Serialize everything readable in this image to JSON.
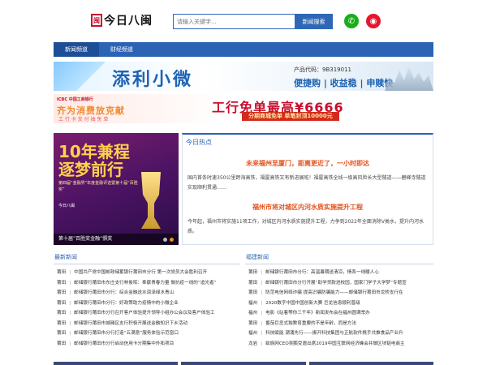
{
  "header": {
    "logo_seal": "闽",
    "logo_text": "今日八闽",
    "search_placeholder": "请输入关键字...",
    "search_button": "新闻搜索"
  },
  "nav": {
    "items": [
      {
        "label": "新闻频道"
      },
      {
        "label": "财经频道"
      }
    ]
  },
  "banner1": {
    "title": "添利小微",
    "product_code": "产品代码：9B319011",
    "slogan": "便捷购 | 收益稳 | 申赎快"
  },
  "banner2": {
    "bank_name": "ICBC 中国工商银行",
    "left_title": "齐为消费放克献",
    "left_sub": "工 行 卡 支 付 抽 免 单",
    "title": "工行免单最高¥6666",
    "subtitle": "分期商城免单 单笔封顶10000元"
  },
  "slider": {
    "big_text_1": "10年兼程",
    "big_text_2": "逐梦前行",
    "small_text": "第四届“金融界”年度金融评选暨第十届“百胜奖”",
    "logo_text": "今日八闽",
    "caption": "第十届”百胜奖金融”颁奖"
  },
  "hot": {
    "tag": "今日热点",
    "headline1": "未来福州至厦门，距离更近了，一小时即达",
    "para1": "国内首条时速350公里跨海高铁，福厦高铁又有新进展啦！福厦高铁全线一级高风险长大型隧道——碧峰寺隧道实现顺利贯通……",
    "headline2": "福州市将对城区内河水质实施提升工程",
    "para2": "今年起，福州市将实施11项工作，对城区内河水质实施提升工程，力争到2022年全面消除V类水，提升内河水质。"
  },
  "latest": {
    "title": "最新新闻",
    "items": [
      {
        "city": "莆田",
        "text": "中国共产党中国邮政储蓄银行莆田市分行 第一次党员大会胜利召开"
      },
      {
        "city": "莆田",
        "text": "邮储银行莆田市东庄支行林俊晖：奉献青春力量 做抗疫一线的“追光者”"
      },
      {
        "city": "莆田",
        "text": "邮储银行莆田市分行：综合金融送水润泽绿水青山"
      },
      {
        "city": "莆田",
        "text": "邮储银行莆田市分行：好政策助力疫情中的小微企业"
      },
      {
        "city": "莆田",
        "text": "邮储银行莆田市分行召开客户体验提升领导小组办公会议及客户体验工"
      },
      {
        "city": "莆田",
        "text": "邮储银行莆田市城厢区支行积极开展送金融知识下乡活动"
      },
      {
        "city": "莆田",
        "text": "邮储银行莆田市分行打造“五满意”服务体验示范窗口"
      },
      {
        "city": "莆田",
        "text": "邮储银行莆田市分行启动信用卡分期集中外拓项目"
      }
    ]
  },
  "fujian": {
    "title": "福建新闻",
    "items": [
      {
        "city": "莆田",
        "text": "邮储银行莆田市分行：高温暑期送清凉，情系一线暖人心"
      },
      {
        "city": "莆田",
        "text": "邮储银行莆田市分行开展“助学贷款进校园，国家门学子大学梦”专题宣"
      },
      {
        "city": "莆田",
        "text": "防范电信网络诈骗 提高识骗防骗能力——邮储银行莆田市龙桥支行在"
      },
      {
        "city": "福州",
        "text": "2020数字中国中国创新大赛 巨龙信息顺利晋级"
      },
      {
        "city": "福州",
        "text": "电影《站着等你三千年》新闻发布会在福州圆满举办"
      },
      {
        "city": "莆田",
        "text": "番茄巨丞式独教育重要的不是年龄，而是方法"
      },
      {
        "city": "福州",
        "text": "科技赋能 潮涌先行——振开科技集团与正航软件携手共推食品产业升"
      },
      {
        "city": "龙岩",
        "text": "蚁族网CEO吴鹏受邀出席2019中国互联网经济峰会并做区块链电商主"
      }
    ]
  },
  "colors": {
    "brand_blue": "#2c63b4",
    "headline_orange": "#e3531d",
    "wechat_green": "#1aad19",
    "weibo_red": "#e6162d"
  },
  "icons": {
    "wechat": "wechat-icon",
    "weibo": "weibo-icon"
  }
}
